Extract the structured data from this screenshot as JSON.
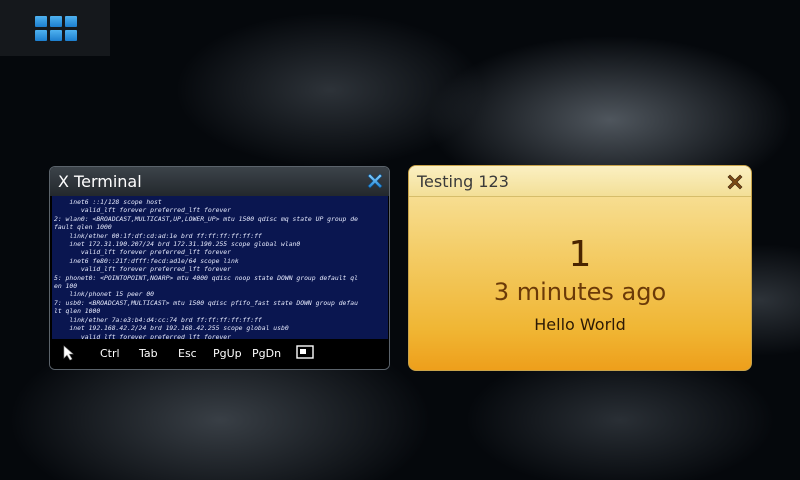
{
  "launcher": {
    "icon": "grid-icon"
  },
  "terminal": {
    "title": "X Terminal",
    "close_icon": "close-x-icon",
    "lines": [
      "    inet6 ::1/128 scope host",
      "       valid_lft forever preferred_lft forever",
      "2: wlan0: <BROADCAST,MULTICAST,UP,LOWER_UP> mtu 1500 qdisc mq state UP group de",
      "fault qlen 1000",
      "    link/ether 00:1f:df:cd:ad:1e brd ff:ff:ff:ff:ff:ff",
      "    inet 172.31.190.207/24 brd 172.31.190.255 scope global wlan0",
      "       valid_lft forever preferred_lft forever",
      "    inet6 fe80::21f:dfff:fecd:ad1e/64 scope link",
      "       valid_lft forever preferred_lft forever",
      "5: phonet0: <POINTOPOINT,NOARP> mtu 4000 qdisc noop state DOWN group default ql",
      "en 100",
      "    link/phonet 15 peer 00",
      "7: usb0: <BROADCAST,MULTICAST> mtu 1500 qdisc pfifo_fast state DOWN group defau",
      "lt qlen 1000",
      "    link/ether 7a:e3:b4:d4:cc:74 brd ff:ff:ff:ff:ff:ff",
      "    inet 192.168.42.2/24 brd 192.168.42.255 scope global usb0",
      "       valid_lft forever preferred_lft forever",
      "user@n900devuan:~$ "
    ],
    "toolbar": {
      "pointer_icon": "pointer-arrow-icon",
      "ctrl": "Ctrl",
      "tab": "Tab",
      "esc": "Esc",
      "pgup": "PgUp",
      "pgdn": "PgDn",
      "window_icon": "window-icon"
    }
  },
  "note": {
    "title": "Testing 123",
    "close_icon": "close-x-icon",
    "count": "1",
    "time": "3 minutes ago",
    "message": "Hello World"
  }
}
